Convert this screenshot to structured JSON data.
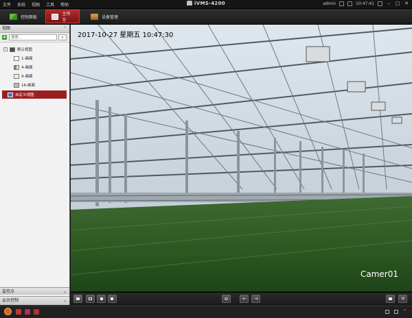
{
  "menubar": {
    "items": [
      "文件",
      "系统",
      "视图",
      "工具",
      "帮助"
    ],
    "app_title": "iVMS-4200",
    "user": "admin",
    "time": "10:47:41"
  },
  "toolbar": {
    "tabs": [
      {
        "label": "控制面板",
        "icon": "control-panel-icon",
        "active": false
      },
      {
        "label": "主预览",
        "icon": "main-preview-icon",
        "active": true
      },
      {
        "label": "设备管理",
        "icon": "device-management-icon",
        "active": false
      }
    ]
  },
  "sidebar": {
    "view_header": "视图",
    "search_placeholder": "搜索...",
    "tree": {
      "default_view": "默认视图",
      "layouts": [
        "1-画面",
        "4-画面",
        "9-画面",
        "16-画面"
      ],
      "custom_view": "自定义视图"
    },
    "monitor_points": "监控点",
    "ptz_control": "云台控制"
  },
  "video": {
    "osd_timestamp": "2017-10-27 星期五 10:47:30",
    "camera_name": "Camer01"
  },
  "colors": {
    "accent": "#9c1f1f",
    "menubar_bg": "#151515",
    "sidebar_bg": "#f2f2f2"
  }
}
